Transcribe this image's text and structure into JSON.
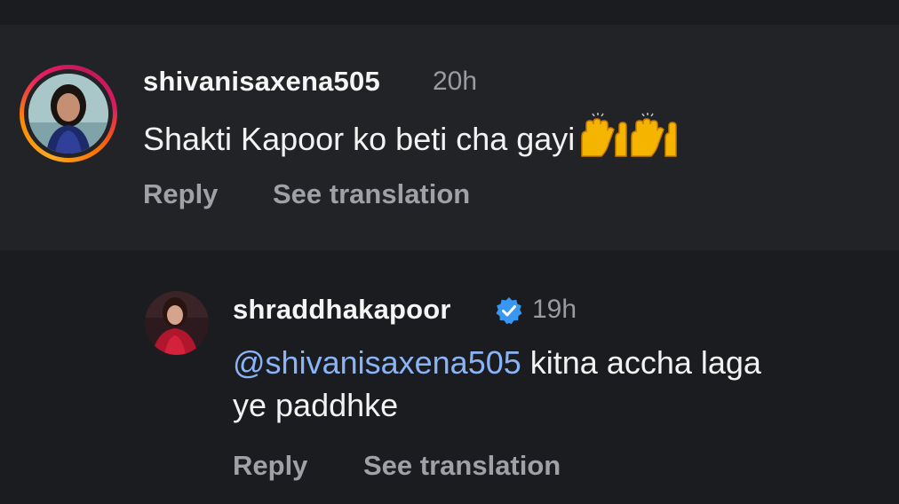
{
  "comment": {
    "username": "shivanisaxena505",
    "time": "20h",
    "text": "Shakti Kapoor ko beti cha gayi",
    "emoji": "🙌🙌",
    "reply_label": "Reply",
    "translate_label": "See translation"
  },
  "reply": {
    "username": "shraddhakapoor",
    "time": "19h",
    "mention": "@shivanisaxena505",
    "text_line1": " kitna accha laga",
    "text_line2": "ye paddhke",
    "reply_label": "Reply",
    "translate_label": "See translation"
  },
  "colors": {
    "background": "#1b1c1f",
    "comment_bg": "#222326",
    "mention": "#8ab4f8",
    "verified": "#3897f0",
    "muted": "#a0a1a6"
  }
}
